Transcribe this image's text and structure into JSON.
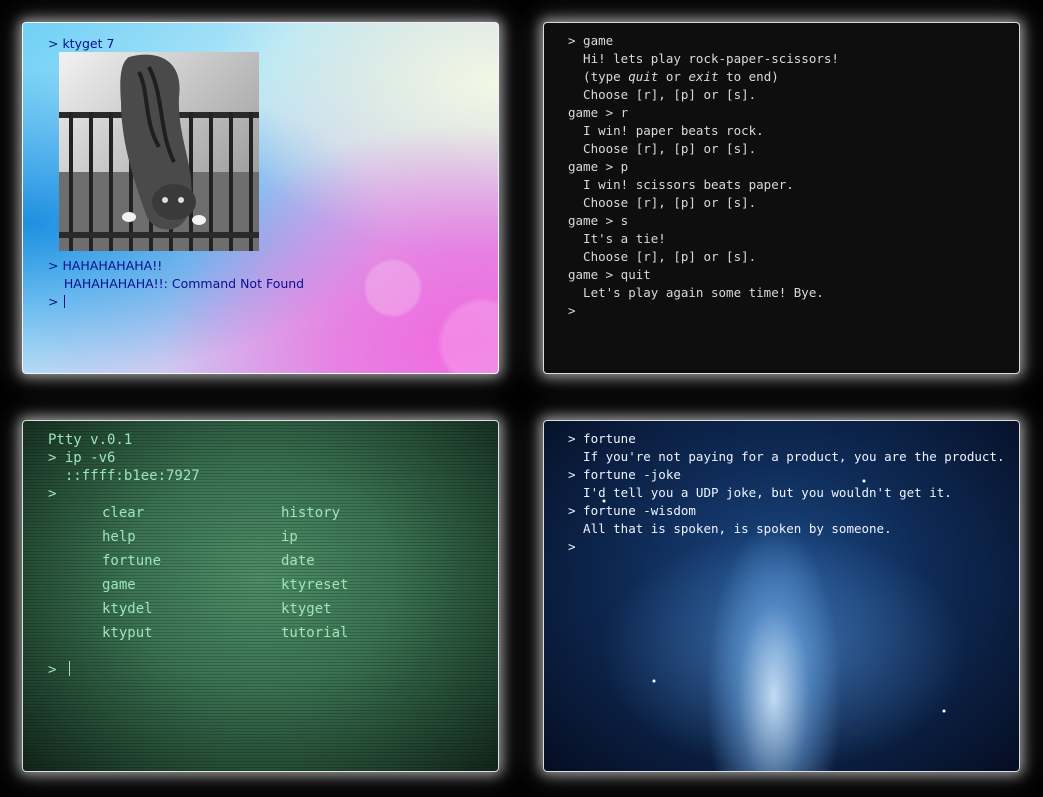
{
  "panel1": {
    "lines": [
      "> ktyget 7",
      "> HAHAHAHAHA!!",
      "    HAHAHAHAHA!!: Command Not Found",
      "> "
    ]
  },
  "panel2": {
    "lines": [
      "> game",
      "  Hi! lets play rock-paper-scissors!",
      "  (type ",
      "  Choose [r], [p] or [s].",
      "game > r",
      "  I win! paper beats rock.",
      "  Choose [r], [p] or [s].",
      "game > p",
      "  I win! scissors beats paper.",
      "  Choose [r], [p] or [s].",
      "game > s",
      "  It's a tie!",
      "  Choose [r], [p] or [s].",
      "game > quit",
      "  Let's play again some time! Bye.",
      ">"
    ],
    "italic_quit": "quit",
    "or_text": " or ",
    "italic_exit": "exit",
    "to_end": " to end)"
  },
  "panel3": {
    "lines": [
      "Ptty v.0.1",
      "> ip -v6",
      "  ::ffff:b1ee:7927",
      ">"
    ],
    "commands": [
      "clear",
      "history",
      "help",
      "ip",
      "fortune",
      "date",
      "game",
      "ktyreset",
      "ktydel",
      "ktyget",
      "ktyput",
      "tutorial"
    ],
    "prompt": "> "
  },
  "panel4": {
    "lines": [
      "> fortune",
      "  If you're not paying for a product, you are the product.",
      "> fortune -joke",
      "  I'd tell you a UDP joke, but you wouldn't get it.",
      "> fortune -wisdom",
      "  All that is spoken, is spoken by someone.",
      ">"
    ]
  },
  "colors": {
    "panel1_text": "#0b0f8c",
    "panel2_text": "#d9d9d9",
    "panel3_text": "#9fe4b8",
    "panel4_text": "#eef3ff"
  }
}
